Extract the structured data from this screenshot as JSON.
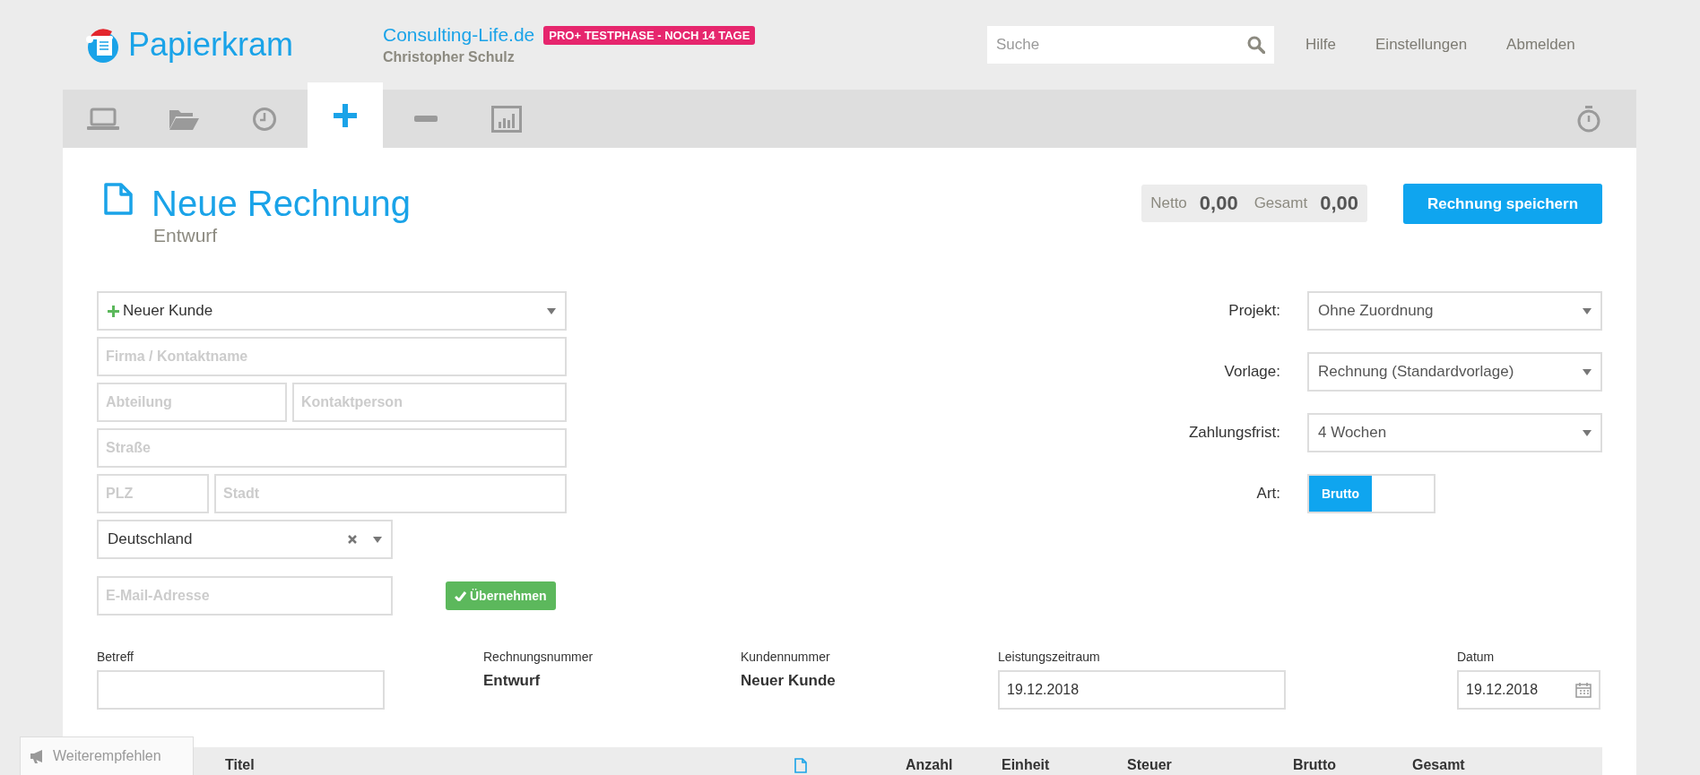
{
  "header": {
    "logo": "Papierkram",
    "company": "Consulting-Life.de",
    "badge": "PRO+ TESTPHASE - NOCH 14 TAGE",
    "user": "Christopher Schulz",
    "search": {
      "placeholder": "Suche"
    },
    "links": [
      "Hilfe",
      "Einstellungen",
      "Abmelden"
    ]
  },
  "nav": {
    "tabs": [
      {
        "kind": "laptop",
        "selected": false
      },
      {
        "kind": "folder",
        "selected": false
      },
      {
        "kind": "clock",
        "selected": false
      },
      {
        "kind": "plus",
        "selected": true
      },
      {
        "kind": "minus",
        "selected": false
      },
      {
        "kind": "chart",
        "selected": false
      }
    ]
  },
  "document": {
    "title": "Neue Rechnung",
    "status": "Entwurf"
  },
  "totals": {
    "net_label": "Netto",
    "net": "0,00",
    "total_label": "Gesamt",
    "total": "0,00"
  },
  "save_button": "Rechnung speichern",
  "customer": {
    "select": "Neuer Kunde",
    "rows": [
      [
        {
          "placeholder": "Firma / Kontaktname",
          "kind": "wide"
        }
      ],
      [
        {
          "placeholder": "Abteilung",
          "kind": "half"
        },
        {
          "placeholder": "Kontaktperson",
          "kind": "half"
        }
      ],
      [
        {
          "placeholder": "Straße",
          "kind": "wide"
        }
      ],
      [
        {
          "placeholder": "PLZ",
          "kind": "short"
        },
        {
          "placeholder": "Stadt",
          "kind": "wide"
        }
      ]
    ],
    "country": "Deutschland",
    "email": {
      "placeholder": "E-Mail-Adresse"
    },
    "apply_button": "Übernehmen"
  },
  "settings": [
    {
      "label": "Projekt:",
      "kind": "select",
      "value": "Ohne Zuordnung"
    },
    {
      "label": "Vorlage:",
      "kind": "select",
      "value": "Rechnung (Standardvorlage)"
    },
    {
      "label": "Zahlungsfrist:",
      "kind": "select",
      "value": "4 Wochen"
    },
    {
      "label": "Art:",
      "kind": "toggle",
      "value": "Brutto",
      "on": true
    }
  ],
  "meta": [
    {
      "label": "Betreff",
      "kind": "input"
    },
    {
      "label": "Rechnungsnummer",
      "kind": "text",
      "value": "Entwurf"
    },
    {
      "label": "Kundennummer",
      "kind": "text",
      "value": "Neuer Kunde"
    },
    {
      "label": "Leistungszeitraum",
      "kind": "input",
      "value": "19.12.2018"
    },
    {
      "label": "Datum",
      "kind": "date",
      "value": "19.12.2018"
    }
  ],
  "positions": {
    "columns": [
      {
        "kind": "text",
        "label": "Titel"
      },
      {
        "kind": "icon"
      },
      {
        "kind": "text",
        "label": "Anzahl"
      },
      {
        "kind": "text",
        "label": "Einheit"
      },
      {
        "kind": "text",
        "label": "Steuer"
      },
      {
        "kind": "text",
        "label": "Brutto"
      },
      {
        "kind": "text",
        "label": "Gesamt"
      }
    ]
  },
  "recommend_button": "Weiterempfehlen"
}
